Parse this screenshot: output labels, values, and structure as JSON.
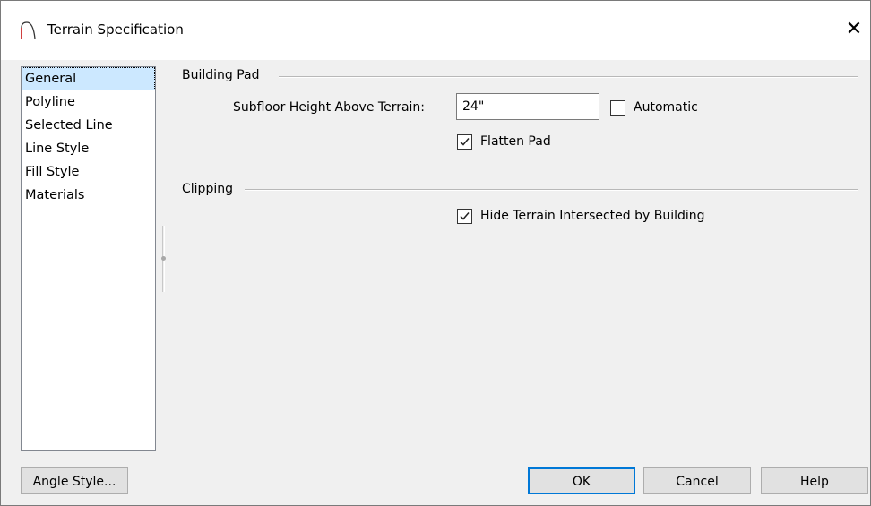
{
  "window": {
    "title": "Terrain Specification",
    "app_icon": "arch-curve-icon",
    "close_glyph": "✕"
  },
  "sidebar": {
    "items": [
      {
        "label": "General",
        "selected": true
      },
      {
        "label": "Polyline"
      },
      {
        "label": "Selected Line"
      },
      {
        "label": "Line Style"
      },
      {
        "label": "Fill Style"
      },
      {
        "label": "Materials"
      }
    ]
  },
  "building_pad": {
    "group_label": "Building Pad",
    "subfloor_label": "Subfloor Height Above Terrain:",
    "subfloor_value": "24\"",
    "automatic_label": "Automatic",
    "automatic_checked": false,
    "flatten_label": "Flatten Pad",
    "flatten_checked": true
  },
  "clipping": {
    "group_label": "Clipping",
    "hide_label": "Hide Terrain Intersected by Building",
    "hide_checked": true
  },
  "buttons": {
    "angle_style": "Angle Style...",
    "ok": "OK",
    "cancel": "Cancel",
    "help": "Help"
  },
  "colors": {
    "selection": "#cce8ff",
    "default_button_border": "#0078d7",
    "icon_red": "#d04040"
  }
}
